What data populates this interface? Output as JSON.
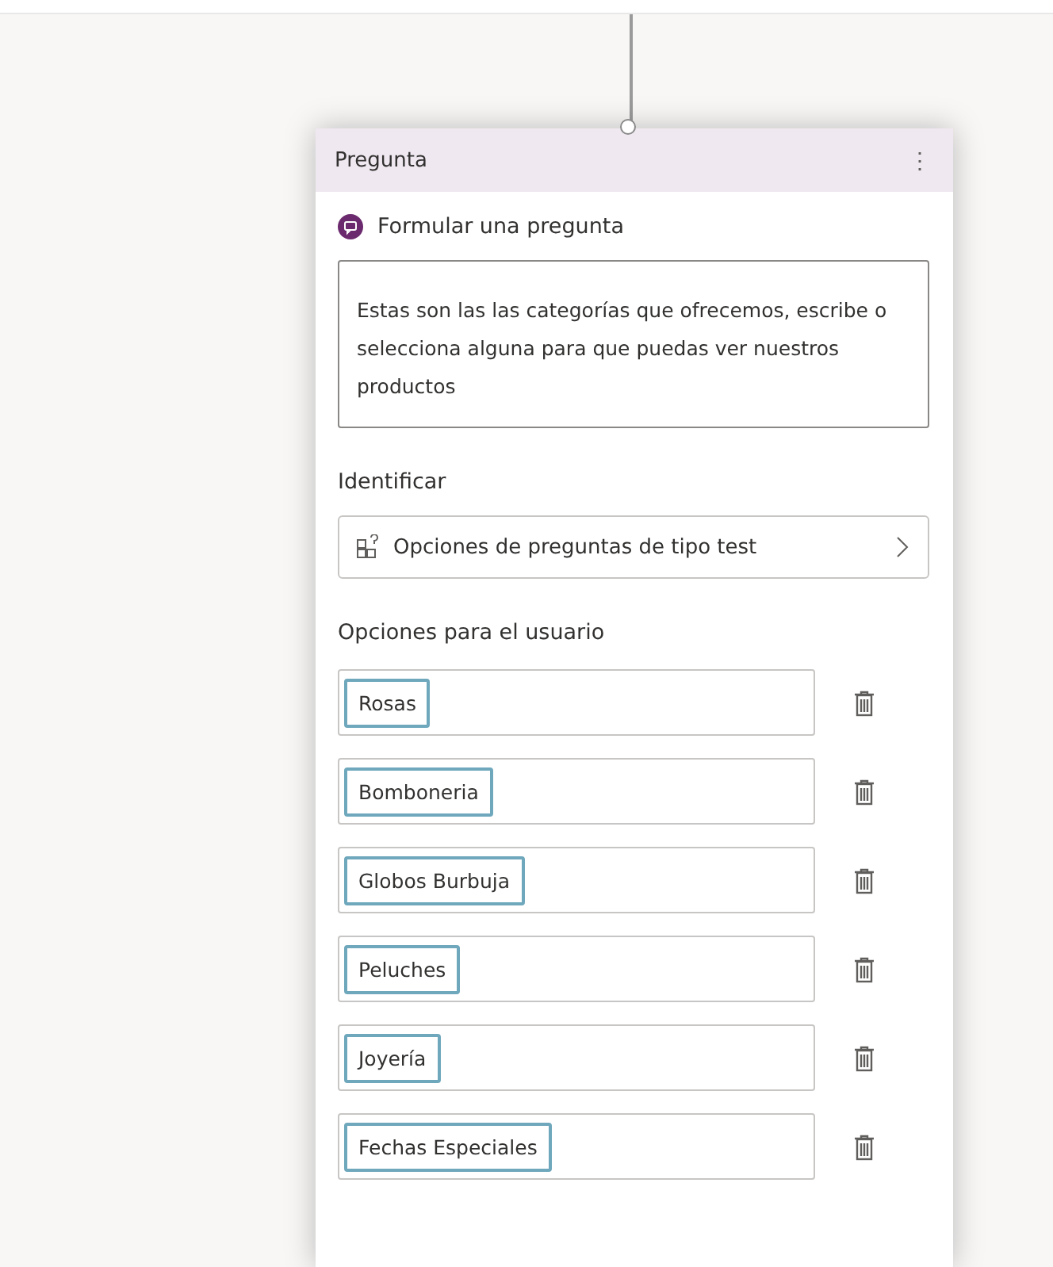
{
  "node": {
    "title": "Pregunta",
    "menu_glyph": "⋮",
    "action": "Formular una pregunta",
    "message": "Estas son las las categorías que ofrecemos, escribe o selecciona alguna para que puedas ver nuestros productos",
    "identify_label": "Identificar",
    "identify_value": "Opciones de preguntas de tipo test",
    "options_label": "Opciones para el usuario",
    "options": [
      {
        "text": "Rosas"
      },
      {
        "text": "Bomboneria"
      },
      {
        "text": "Globos Burbuja"
      },
      {
        "text": "Peluches"
      },
      {
        "text": "Joyería"
      },
      {
        "text": "Fechas Especiales"
      }
    ]
  }
}
